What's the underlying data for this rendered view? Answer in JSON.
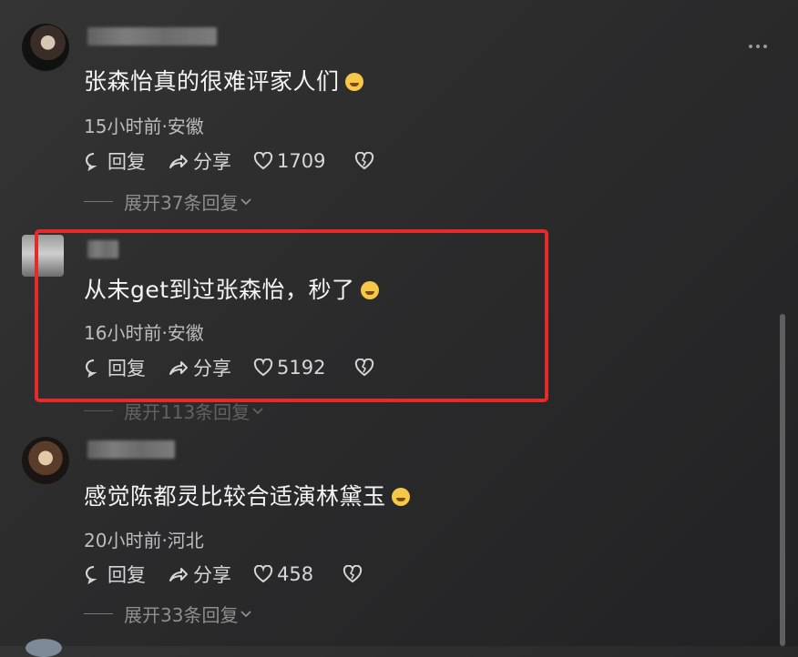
{
  "comments": [
    {
      "text": "张森怡真的很难评家人们",
      "meta": "15小时前·安徽",
      "reply_label": "回复",
      "share_label": "分享",
      "likes": "1709",
      "expand_text": "展开37条回复"
    },
    {
      "text": "从未get到过张森怡，秒了",
      "meta": "16小时前·安徽",
      "reply_label": "回复",
      "share_label": "分享",
      "likes": "5192",
      "expand_text": "展开113条回复"
    },
    {
      "text": "感觉陈都灵比较合适演林黛玉",
      "meta": "20小时前·河北",
      "reply_label": "回复",
      "share_label": "分享",
      "likes": "458",
      "expand_text": "展开33条回复"
    }
  ],
  "icons": {
    "more": "more-dots-icon",
    "reply": "comment-bubble-icon",
    "share": "share-arrow-icon",
    "like": "heart-icon",
    "dislike": "broken-heart-icon"
  },
  "colors": {
    "highlight": "#e42a2a",
    "background": "#2b2b2c"
  }
}
